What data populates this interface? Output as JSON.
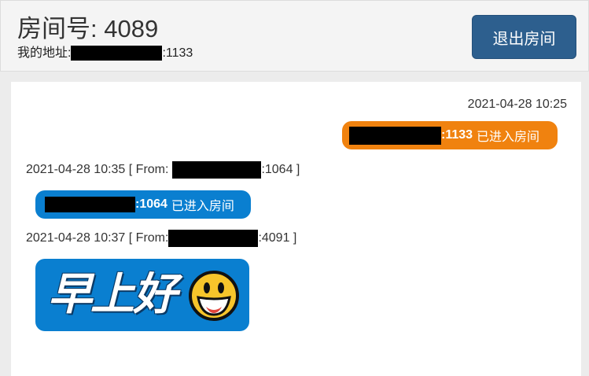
{
  "header": {
    "room_label": "房间号: 4089",
    "address_label": "我的地址:",
    "address_port": ":1133",
    "exit_button": "退出房间"
  },
  "messages": [
    {
      "time": "2021-04-28 10:25",
      "port": ":1133",
      "text": "已进入房间"
    },
    {
      "time_from": "2021-04-28 10:35 [ From:",
      "from_port": ":1064 ]",
      "port": ":1064",
      "text": "已进入房间"
    },
    {
      "time_from": "2021-04-28 10:37 [ From:",
      "from_port": ":4091 ]",
      "sticker_text": "早上好"
    }
  ],
  "colors": {
    "header_bg": "#f4f4f4",
    "exit_button": "#2d5f8e",
    "self_bubble": "#f0820f",
    "other_bubble": "#0a7fd0"
  },
  "icons": [
    "smiley-face-icon"
  ]
}
